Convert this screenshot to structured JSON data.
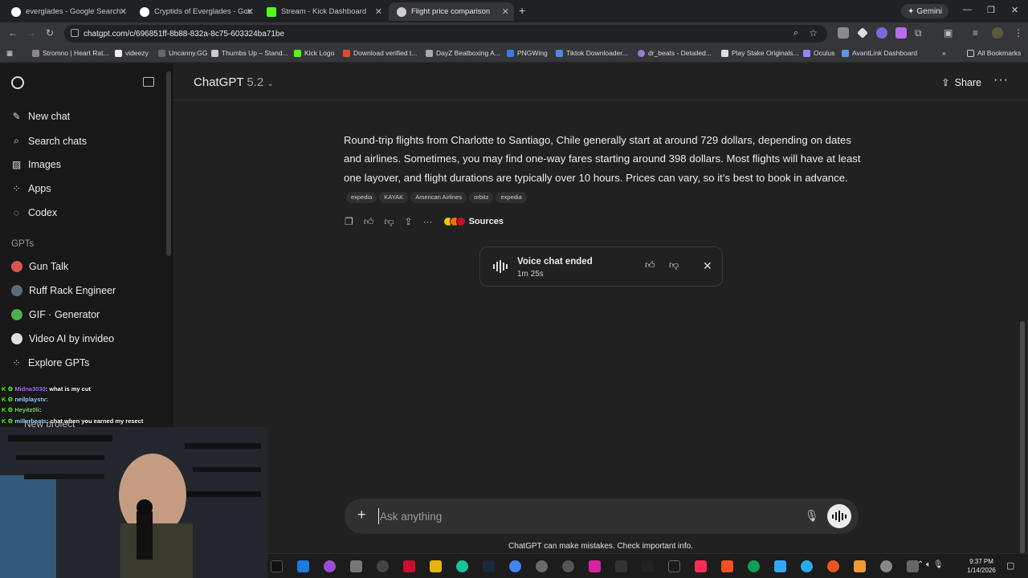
{
  "browser": {
    "tabs": [
      {
        "title": "everglades - Google Search",
        "active": false
      },
      {
        "title": "Cryptids of Everglades - Google",
        "active": false
      },
      {
        "title": "Stream - Kick Dashboard",
        "active": false
      },
      {
        "title": "Flight price comparison",
        "active": true
      }
    ],
    "new_tab": "+",
    "gemini_label": "Gemini",
    "url": "chatgpt.com/c/696851ff-8b88-832a-8c75-603324ba71be",
    "bookmarks": [
      "Stromno | Heart Rat...",
      "videezy",
      "Uncanny.GG",
      "Thumbs Up – Stand...",
      "Kick Logo",
      "Download verified t...",
      "DayZ Beatboxing A...",
      "PNGWing",
      "Tiktok Downloader...",
      "dr_beats - Detailed...",
      "Play Stake Originals...",
      "Oculus",
      "AvantLink Dashboard"
    ],
    "all_bookmarks": "All Bookmarks"
  },
  "sidebar": {
    "items": [
      {
        "label": "New chat",
        "icon": "edit-icon"
      },
      {
        "label": "Search chats",
        "icon": "search-icon"
      },
      {
        "label": "Images",
        "icon": "image-icon"
      },
      {
        "label": "Apps",
        "icon": "apps-icon"
      },
      {
        "label": "Codex",
        "icon": "codex-icon"
      }
    ],
    "gpts_label": "GPTs",
    "gpts": [
      {
        "label": "Gun Talk",
        "color": "#d9534f"
      },
      {
        "label": "Ruff Rack Engineer",
        "color": "#5b6b7a"
      },
      {
        "label": "GIF · Generator",
        "color": "#4caf50"
      },
      {
        "label": "Video AI by invideo",
        "color": "#e0e0e0"
      },
      {
        "label": "Explore GPTs",
        "color": ""
      }
    ],
    "new_project": "New project"
  },
  "header": {
    "model": "ChatGPT",
    "version": "5.2",
    "share": "Share"
  },
  "answer": {
    "text": "Round-trip flights from Charlotte to Santiago, Chile generally start at around 729 dollars, depending on dates and airlines. Sometimes, you may find one-way fares starting around 398 dollars. Most flights will have at least one layover, and flight durations are typically over 10 hours. Prices can vary, so it’s best to book in advance.",
    "citations": [
      "expedia",
      "KAYAK",
      "American Airlines",
      "orbitz",
      "expedia"
    ],
    "sources_label": "Sources"
  },
  "voice_card": {
    "title": "Voice chat ended",
    "duration": "1m 25s"
  },
  "composer": {
    "placeholder": "Ask anything",
    "disclaimer": "ChatGPT can make mistakes. Check important info."
  },
  "stream_chat": [
    {
      "user": "Midna3030",
      "msg": ": what is my cut"
    },
    {
      "user": "neilplaystv",
      "msg": ":"
    },
    {
      "user": "Heyitz0li",
      "msg": ":"
    },
    {
      "user": "millerbeats",
      "msg": ": chat when you earned my resect"
    }
  ],
  "clock": {
    "time": "9:37 PM",
    "date": "1/14/2026"
  }
}
